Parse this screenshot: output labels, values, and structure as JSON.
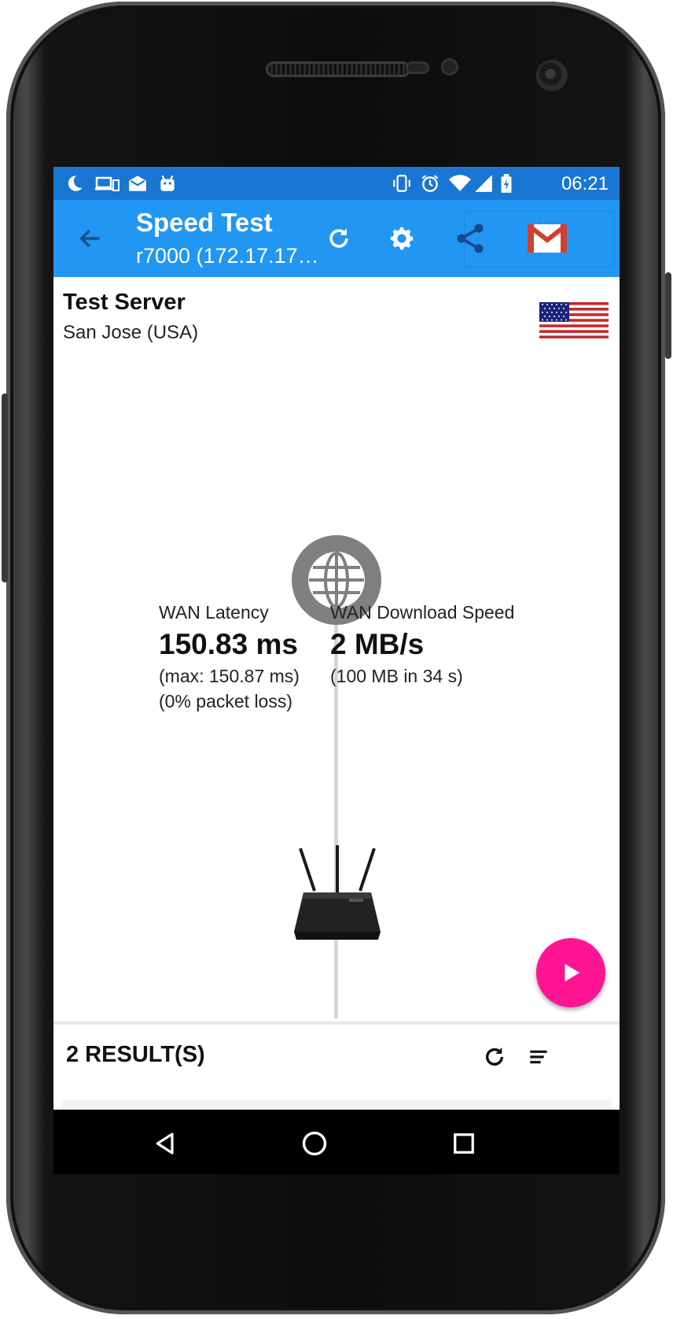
{
  "status_bar": {
    "time": "06:21",
    "left_icons": [
      "moon-icon",
      "devices-icon",
      "mail-icon",
      "android-icon"
    ],
    "right_icons": [
      "vibrate-icon",
      "alarm-icon",
      "wifi-icon",
      "signal-icon",
      "battery-icon"
    ]
  },
  "app_bar": {
    "title": "Speed Test",
    "subtitle": "r7000 (172.17.17…",
    "actions": [
      "back-icon",
      "refresh-icon",
      "settings-icon",
      "share-icon",
      "gmail-icon"
    ],
    "color": "#2196f3"
  },
  "server": {
    "title": "Test Server",
    "location": "San Jose (USA)",
    "flag": "usa-flag-icon"
  },
  "latency": {
    "label": "WAN Latency",
    "value": "150.83 ms",
    "max": "(max: 150.87 ms)",
    "loss": "(0% packet loss)"
  },
  "download": {
    "label": "WAN Download Speed",
    "value": "2 MB/s",
    "detail": "(100 MB in 34 s)"
  },
  "results": {
    "label": "2 RESULT(S)"
  },
  "fab": {
    "icon": "play-icon",
    "color": "#ff1493"
  },
  "nav": [
    "back-triangle-icon",
    "home-circle-icon",
    "recents-square-icon"
  ]
}
